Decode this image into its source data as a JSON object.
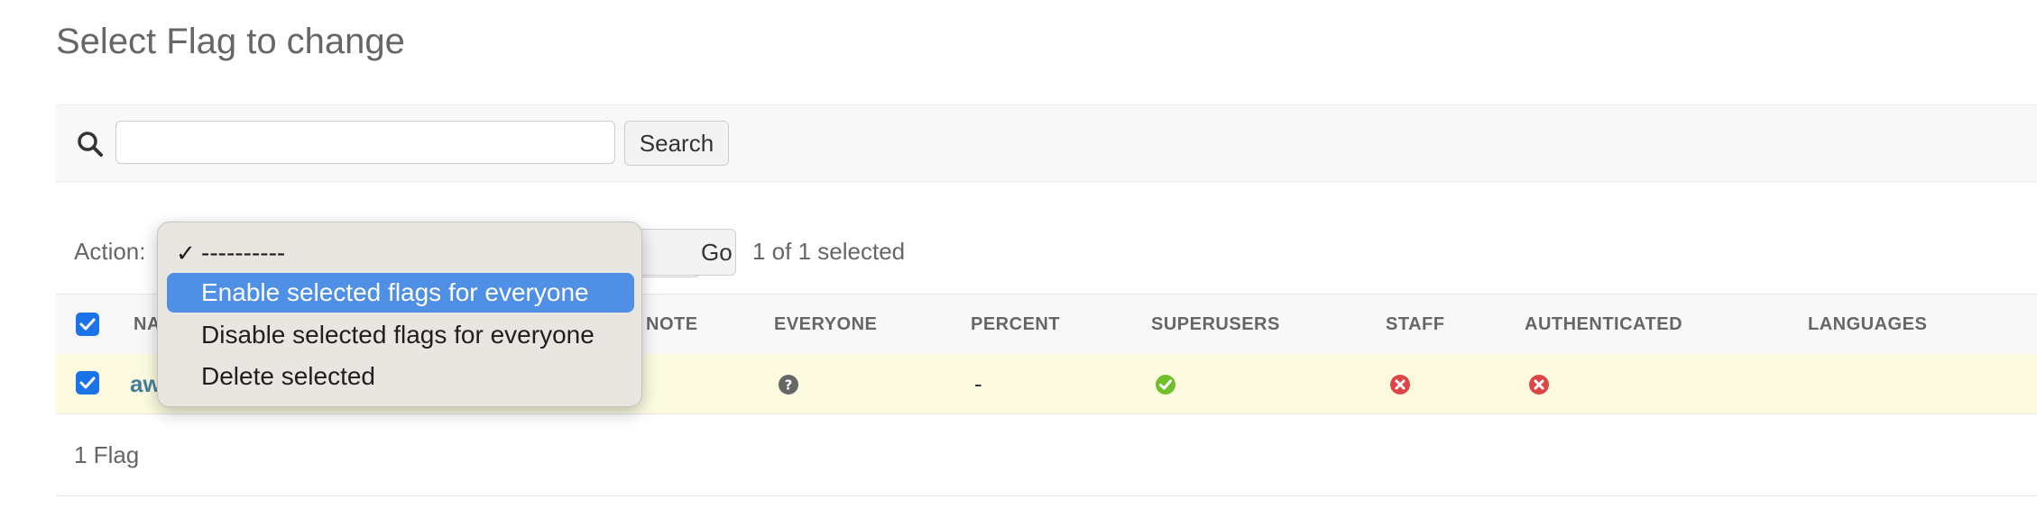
{
  "page": {
    "title": "Select Flag to change"
  },
  "search": {
    "placeholder": "",
    "value": "",
    "button_label": "Search"
  },
  "actions": {
    "label": "Action:",
    "go_label": "Go",
    "selected_count": "1 of 1 selected",
    "options": [
      {
        "label": "----------",
        "checked": true,
        "highlighted": false
      },
      {
        "label": "Enable selected flags for everyone",
        "checked": false,
        "highlighted": true
      },
      {
        "label": "Disable selected flags for everyone",
        "checked": false,
        "highlighted": false
      },
      {
        "label": "Delete selected",
        "checked": false,
        "highlighted": false
      }
    ]
  },
  "table": {
    "columns": [
      "NAME",
      "NOTE",
      "EVERYONE",
      "PERCENT",
      "SUPERUSERS",
      "STAFF",
      "AUTHENTICATED",
      "LANGUAGES"
    ],
    "visible_header_fragments": {
      "name": "NA",
      "note": "NOTE"
    },
    "rows": [
      {
        "name": "aw",
        "selected": true,
        "everyone": "unknown",
        "percent": "-",
        "superusers": "yes",
        "staff": "no",
        "authenticated": "no",
        "languages": ""
      }
    ]
  },
  "paginator": {
    "text": "1 Flag"
  },
  "colors": {
    "checkbox": "#1a73e8",
    "yes_icon": "#70bf2b",
    "no_icon": "#dd4646",
    "unknown_icon": "#666666",
    "row_highlight": "#fcfbe0",
    "link": "#447e9b",
    "dropdown_highlight": "#4f8fe6"
  },
  "icons": {
    "search": "search-icon",
    "yes": "check-circle-icon",
    "no": "x-circle-icon",
    "unknown": "question-circle-icon"
  }
}
